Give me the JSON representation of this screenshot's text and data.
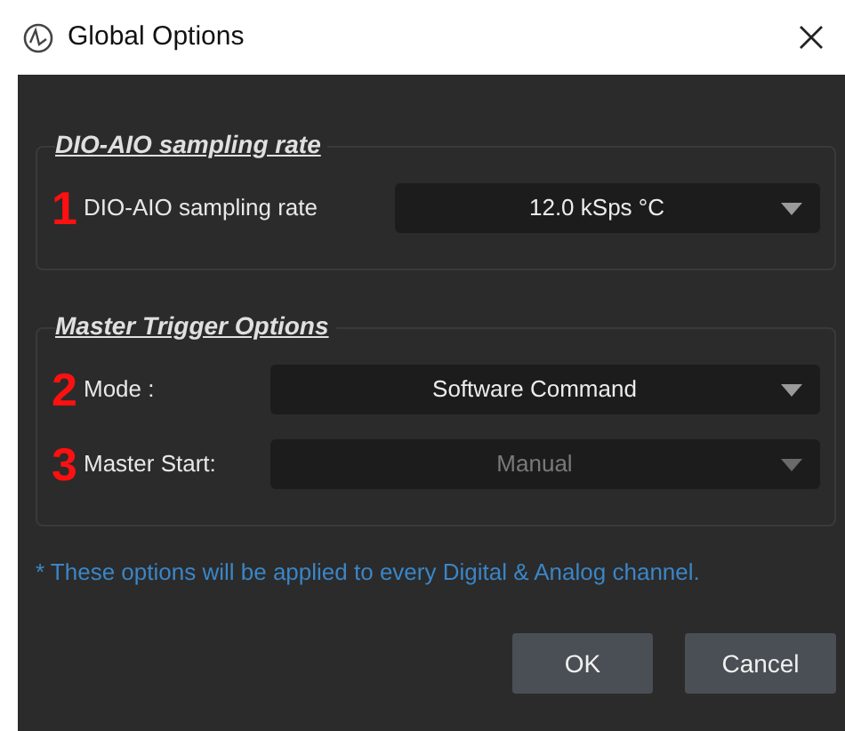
{
  "window": {
    "title": "Global Options"
  },
  "groups": [
    {
      "title": "DIO-AIO sampling rate",
      "fields": [
        {
          "marker": "1",
          "label": "DIO-AIO sampling rate",
          "value": "12.0 kSps °C",
          "disabled": false
        }
      ]
    },
    {
      "title": "Master Trigger Options",
      "fields": [
        {
          "marker": "2",
          "label": "Mode :",
          "value": "Software Command",
          "disabled": false
        },
        {
          "marker": "3",
          "label": "Master Start:",
          "value": "Manual",
          "disabled": true
        }
      ]
    }
  ],
  "note": "* These options will be applied to every Digital & Analog channel.",
  "buttons": [
    "OK",
    "Cancel"
  ]
}
